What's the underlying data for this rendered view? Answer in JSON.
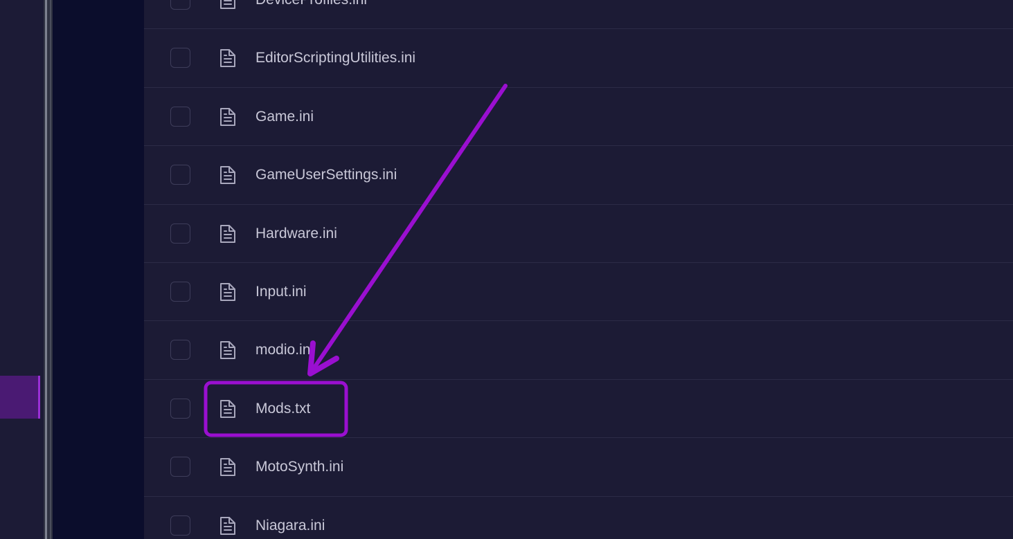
{
  "files": [
    {
      "name": "DeviceProfiles.ini",
      "icon": "file-icon"
    },
    {
      "name": "EditorScriptingUtilities.ini",
      "icon": "file-icon"
    },
    {
      "name": "Game.ini",
      "icon": "file-icon"
    },
    {
      "name": "GameUserSettings.ini",
      "icon": "file-icon"
    },
    {
      "name": "Hardware.ini",
      "icon": "file-icon"
    },
    {
      "name": "Input.ini",
      "icon": "file-icon"
    },
    {
      "name": "modio.ini",
      "icon": "file-icon"
    },
    {
      "name": "Mods.txt",
      "icon": "file-icon",
      "highlighted": true
    },
    {
      "name": "MotoSynth.ini",
      "icon": "file-icon"
    },
    {
      "name": "Niagara.ini",
      "icon": "file-icon"
    }
  ],
  "annotation": {
    "type": "arrow-and-box",
    "target": "Mods.txt",
    "color": "#9a0fd0"
  },
  "colors": {
    "background": "#1c1b35",
    "dark_panel": "#0b0d2c",
    "sidebar_active": "#4a1a73",
    "text": "#c9c8d8"
  }
}
